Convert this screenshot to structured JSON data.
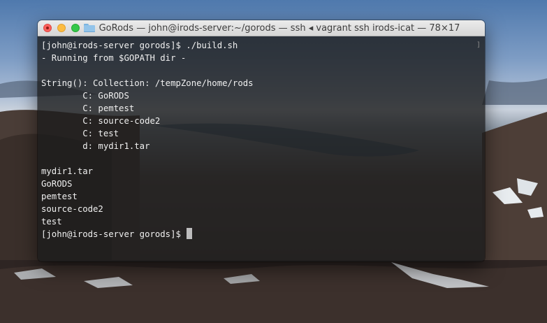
{
  "window": {
    "title": "GoRods — john@irods-server:~/gorods — ssh ◂ vagrant ssh irods-icat — 78×17"
  },
  "terminal": {
    "lines": [
      "[john@irods-server gorods]$ ./build.sh",
      "- Running from $GOPATH dir -",
      "",
      "String(): Collection: /tempZone/home/rods",
      "        C: GoRODS",
      "        C: pemtest",
      "        C: source-code2",
      "        C: test",
      "        d: mydir1.tar",
      "",
      "mydir1.tar",
      "GoRODS",
      "pemtest",
      "source-code2",
      "test",
      "[john@irods-server gorods]$ "
    ]
  },
  "colors": {
    "close": "#fc605c",
    "minimize": "#fdbc40",
    "maximize": "#34c84a",
    "terminal_bg": "#1c1c1c",
    "terminal_text": "#f0f0f0"
  },
  "icons": [
    "folder-icon",
    "close-icon",
    "minimize-icon",
    "maximize-icon"
  ]
}
